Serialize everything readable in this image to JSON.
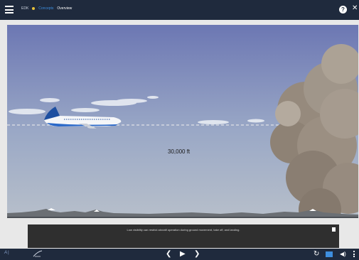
{
  "topbar": {
    "crumb_1": "EDK",
    "crumb_2": "Concepts",
    "crumb_3": "Overview"
  },
  "scene": {
    "altitude_label": "30,000 ft"
  },
  "caption": {
    "text": "Low visibility can restrict aircraft operation during ground movement, take off, and landing."
  },
  "colors": {
    "bar_bg": "#1f2a3d",
    "accent": "#3e8ede",
    "sky_top": "#6f7ab5",
    "sky_bottom": "#a9b6c8"
  }
}
